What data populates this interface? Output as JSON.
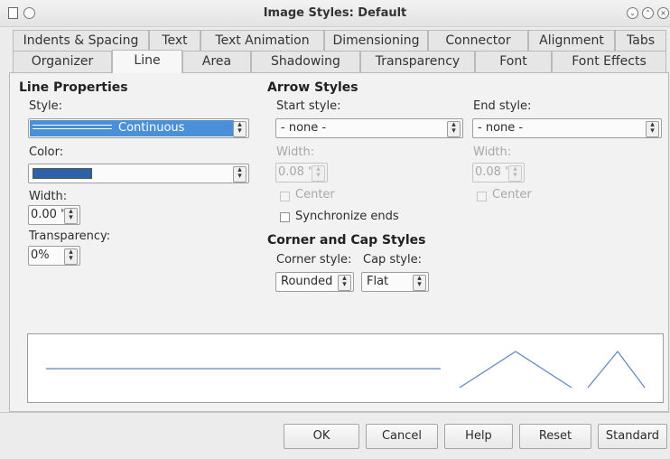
{
  "window": {
    "title": "Image Styles: Default"
  },
  "tabs_row1": [
    "Indents & Spacing",
    "Text",
    "Text Animation",
    "Dimensioning",
    "Connector",
    "Alignment",
    "Tabs"
  ],
  "tabs_row2": [
    "Organizer",
    "Line",
    "Area",
    "Shadowing",
    "Transparency",
    "Font",
    "Font Effects"
  ],
  "active_tab": "Line",
  "line_properties": {
    "header": "Line Properties",
    "style_label": "Style:",
    "style_value": "Continuous",
    "color_label": "Color:",
    "color_value": "#2e62a6",
    "width_label": "Width:",
    "width_value": "0.00 \"",
    "transparency_label": "Transparency:",
    "transparency_value": "0%"
  },
  "arrow_styles": {
    "header": "Arrow Styles",
    "start_label": "Start style:",
    "start_value": "- none -",
    "end_label": "End style:",
    "end_value": "- none -",
    "start_width_label": "Width:",
    "start_width_value": "0.08 \"",
    "end_width_label": "Width:",
    "end_width_value": "0.08 \"",
    "start_center_label": "Center",
    "end_center_label": "Center",
    "sync_label": "Synchronize ends"
  },
  "corner_cap": {
    "header": "Corner and Cap Styles",
    "corner_label": "Corner style:",
    "corner_value": "Rounded",
    "cap_label": "Cap style:",
    "cap_value": "Flat"
  },
  "preview": {
    "line_color": "#5d86c2"
  },
  "buttons": {
    "ok": "OK",
    "cancel": "Cancel",
    "help": "Help",
    "reset": "Reset",
    "standard": "Standard"
  }
}
